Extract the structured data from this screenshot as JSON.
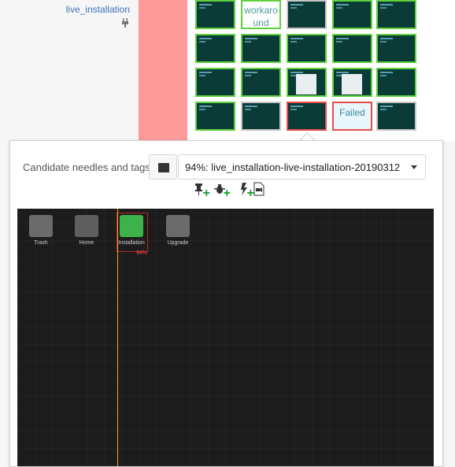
{
  "test_row": {
    "module_label": "live_installation"
  },
  "thumbnails": [
    [
      {
        "type": "dark",
        "state": "ok"
      },
      {
        "type": "text",
        "state": "ok",
        "text": "workaro und"
      },
      {
        "type": "dark",
        "state": "grey"
      },
      {
        "type": "dark",
        "state": "ok"
      },
      {
        "type": "dark",
        "state": "ok"
      }
    ],
    [
      {
        "type": "dark",
        "state": "ok"
      },
      {
        "type": "dark",
        "state": "ok"
      },
      {
        "type": "dark",
        "state": "ok"
      },
      {
        "type": "dark",
        "state": "ok"
      },
      {
        "type": "dark",
        "state": "ok"
      }
    ],
    [
      {
        "type": "dark",
        "state": "ok"
      },
      {
        "type": "dark",
        "state": "ok"
      },
      {
        "type": "win",
        "state": "ok"
      },
      {
        "type": "win",
        "state": "ok"
      },
      {
        "type": "dark",
        "state": "ok"
      }
    ],
    [
      {
        "type": "dark",
        "state": "ok"
      },
      {
        "type": "dark",
        "state": "grey"
      },
      {
        "type": "dark",
        "state": "fail"
      },
      {
        "type": "text",
        "state": "fail",
        "text": "Failed"
      },
      {
        "type": "dark",
        "state": "grey"
      }
    ]
  ],
  "popover": {
    "label": "Candidate needles and tags:",
    "selected_needle": "94%: live_installation-live-installation-20190312",
    "tools": [
      "pin-plus-icon",
      "bug-plus-icon",
      "bolt-plus-icon",
      "file-video-icon"
    ]
  },
  "desktop": {
    "icons": [
      {
        "name": "trash",
        "label": "Trash"
      },
      {
        "name": "home",
        "label": "Home"
      },
      {
        "name": "install",
        "label": "Installation"
      },
      {
        "name": "upgrade",
        "label": "Upgrade"
      }
    ],
    "match_percent": "94%"
  }
}
